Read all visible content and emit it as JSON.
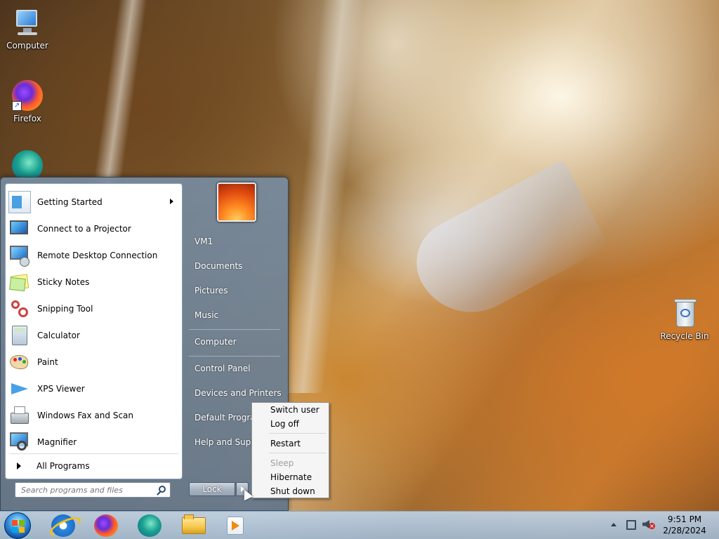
{
  "desktop": {
    "icons": [
      {
        "label": "Computer"
      },
      {
        "label": "Firefox"
      },
      {
        "label": "Recycle Bin"
      }
    ]
  },
  "start_menu": {
    "programs": [
      {
        "label": "Getting Started",
        "icon": "getting-started-icon",
        "submenu": true
      },
      {
        "label": "Connect to a Projector",
        "icon": "projector-icon"
      },
      {
        "label": "Remote Desktop Connection",
        "icon": "remote-desktop-icon"
      },
      {
        "label": "Sticky Notes",
        "icon": "sticky-notes-icon"
      },
      {
        "label": "Snipping Tool",
        "icon": "scissors-icon"
      },
      {
        "label": "Calculator",
        "icon": "calculator-icon"
      },
      {
        "label": "Paint",
        "icon": "paint-palette-icon"
      },
      {
        "label": "XPS Viewer",
        "icon": "paper-plane-icon"
      },
      {
        "label": "Windows Fax and Scan",
        "icon": "fax-icon"
      },
      {
        "label": "Magnifier",
        "icon": "magnifier-icon"
      }
    ],
    "all_programs": "All Programs",
    "search_placeholder": "Search programs and files",
    "right_items": [
      "VM1",
      "Documents",
      "Pictures",
      "Music",
      "Computer",
      "Control Panel",
      "Devices and Printers",
      "Default Programs",
      "Help and Support"
    ],
    "lock_label": "Lock"
  },
  "power_menu": {
    "items": [
      {
        "label": "Switch user",
        "enabled": true
      },
      {
        "label": "Log off",
        "enabled": true
      },
      {
        "label": "Restart",
        "enabled": true
      },
      {
        "label": "Sleep",
        "enabled": false
      },
      {
        "label": "Hibernate",
        "enabled": true
      },
      {
        "label": "Shut down",
        "enabled": true
      }
    ]
  },
  "taskbar": {
    "pinned": [
      "internet-explorer-icon",
      "firefox-icon",
      "edge-icon",
      "file-explorer-icon",
      "media-player-icon"
    ],
    "clock": {
      "time": "9:51 PM",
      "date": "2/28/2024"
    }
  },
  "colors": {
    "menu_glass": "#788ca0",
    "taskbar": "#b4cce4",
    "disabled_text": "#a0a0a0"
  }
}
